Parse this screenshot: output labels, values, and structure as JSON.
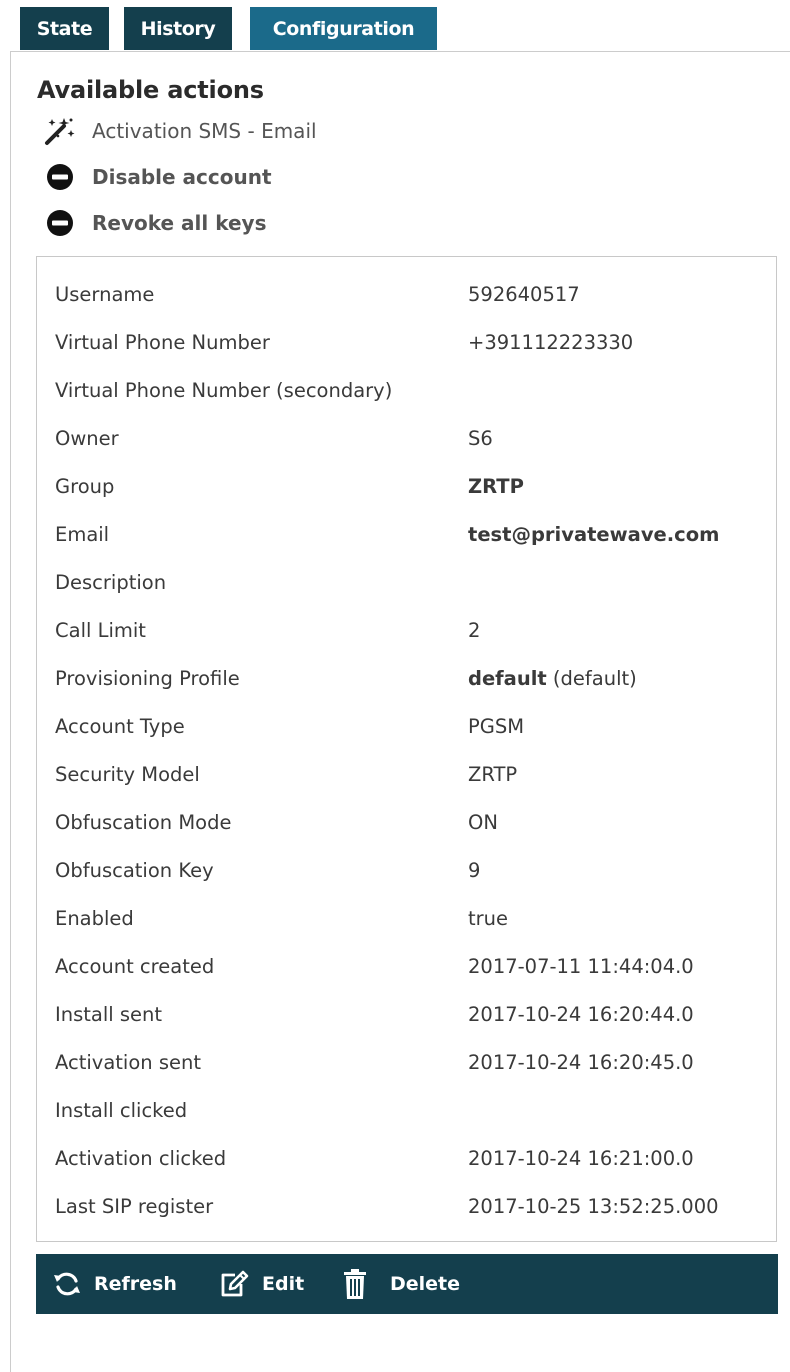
{
  "tabs": [
    {
      "label": "State",
      "active": false
    },
    {
      "label": "History",
      "active": false
    },
    {
      "label": "Configuration",
      "active": true
    }
  ],
  "actions": {
    "title": "Available actions",
    "items": [
      {
        "label": "Activation SMS - Email",
        "icon": "magic-wand-icon"
      },
      {
        "label": "Disable account",
        "icon": "minus-circle-icon"
      },
      {
        "label": "Revoke all keys",
        "icon": "minus-circle-icon"
      }
    ]
  },
  "details": {
    "rows": [
      {
        "key": "Username",
        "value": "592640517"
      },
      {
        "key": "Virtual Phone Number",
        "value": "+391112223330"
      },
      {
        "key": "Virtual Phone Number (secondary)",
        "value": ""
      },
      {
        "key": "Owner",
        "value": "S6"
      },
      {
        "key": "Group",
        "value": "ZRTP"
      },
      {
        "key": "Email",
        "value": "test@privatewave.com"
      },
      {
        "key": "Description",
        "value": ""
      },
      {
        "key": "Call Limit",
        "value": "2"
      },
      {
        "key": "Provisioning Profile",
        "value": "default",
        "value_suffix": "(default)"
      },
      {
        "key": "Account Type",
        "value": "PGSM"
      },
      {
        "key": "Security Model",
        "value": "ZRTP"
      },
      {
        "key": "Obfuscation Mode",
        "value": "ON"
      },
      {
        "key": "Obfuscation Key",
        "value": "9"
      },
      {
        "key": "Enabled",
        "value": "true"
      },
      {
        "key": "Account created",
        "value": "2017-07-11 11:44:04.0"
      },
      {
        "key": "Install sent",
        "value": "2017-10-24 16:20:44.0"
      },
      {
        "key": "Activation sent",
        "value": "2017-10-24 16:20:45.0"
      },
      {
        "key": "Install clicked",
        "value": ""
      },
      {
        "key": "Activation clicked",
        "value": "2017-10-24 16:21:00.0"
      },
      {
        "key": "Last SIP register",
        "value": "2017-10-25 13:52:25.000"
      }
    ]
  },
  "footer": {
    "refresh_label": "Refresh",
    "edit_label": "Edit",
    "delete_label": "Delete"
  },
  "colors": {
    "tab_bg": "#143f4d",
    "tab_active_bg": "#1b6a8a",
    "footer_bg": "#143f4d"
  }
}
